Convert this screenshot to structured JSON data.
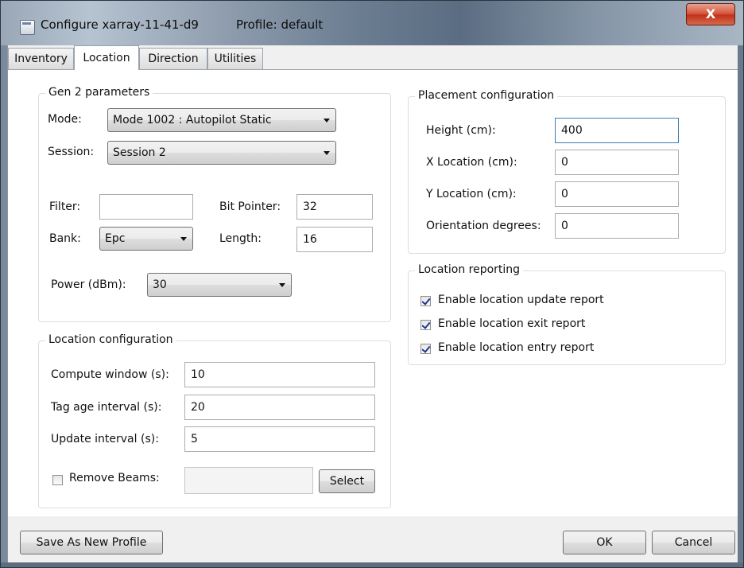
{
  "window": {
    "title": "Configure xarray-11-41-d9",
    "profile": "Profile: default",
    "close_glyph": "X",
    "icon": "window-app-icon"
  },
  "tabs": [
    {
      "label": "Inventory",
      "active": false
    },
    {
      "label": "Location",
      "active": true
    },
    {
      "label": "Direction",
      "active": false
    },
    {
      "label": "Utilities",
      "active": false
    }
  ],
  "gen2": {
    "legend": "Gen 2 parameters",
    "mode_label": "Mode:",
    "mode_value": "Mode 1002 : Autopilot Static",
    "session_label": "Session:",
    "session_value": "Session 2",
    "filter_label": "Filter:",
    "filter_value": "",
    "bit_pointer_label": "Bit Pointer:",
    "bit_pointer_value": "32",
    "bank_label": "Bank:",
    "bank_value": "Epc",
    "length_label": "Length:",
    "length_value": "16",
    "power_label": "Power (dBm):",
    "power_value": "30"
  },
  "location_config": {
    "legend": "Location configuration",
    "compute_window_label": "Compute window (s):",
    "compute_window_value": "10",
    "tag_age_label": "Tag age interval (s):",
    "tag_age_value": "20",
    "update_interval_label": "Update interval (s):",
    "update_interval_value": "5",
    "remove_beams_label": "Remove Beams:",
    "remove_beams_checked": false,
    "remove_beams_value": "",
    "select_label": "Select"
  },
  "placement": {
    "legend": "Placement configuration",
    "height_label": "Height (cm):",
    "height_value": "400",
    "x_label": "X Location (cm):",
    "x_value": "0",
    "y_label": "Y Location (cm):",
    "y_value": "0",
    "orientation_label": "Orientation degrees:",
    "orientation_value": "0"
  },
  "reporting": {
    "legend": "Location reporting",
    "update_report_label": "Enable location update report",
    "update_report_checked": true,
    "exit_report_label": "Enable location exit report",
    "exit_report_checked": true,
    "entry_report_label": "Enable location entry report",
    "entry_report_checked": true
  },
  "footer": {
    "save_profile_label": "Save As New Profile",
    "ok_label": "OK",
    "cancel_label": "Cancel"
  }
}
